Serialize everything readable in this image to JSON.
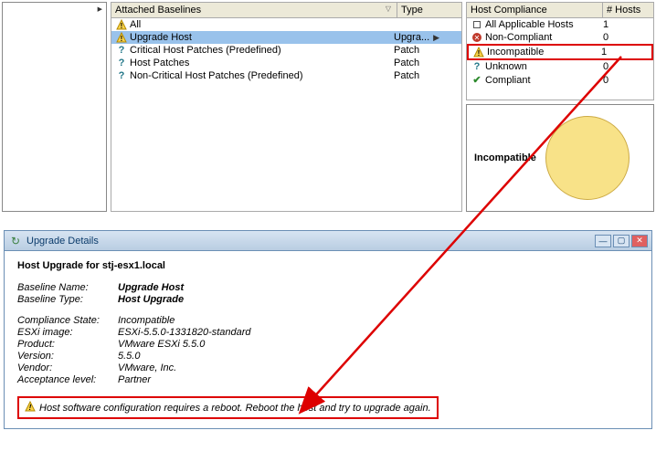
{
  "baselines": {
    "header_name": "Attached Baselines",
    "header_type": "Type",
    "items": [
      {
        "icon": "warn",
        "label": "All",
        "type": ""
      },
      {
        "icon": "warn",
        "label": "Upgrade Host",
        "type": "Upgra...",
        "selected": true,
        "arrow": true
      },
      {
        "icon": "help",
        "label": "Critical Host Patches (Predefined)",
        "type": "Patch"
      },
      {
        "icon": "help",
        "label": "Host Patches",
        "type": "Patch"
      },
      {
        "icon": "help",
        "label": "Non-Critical Host Patches (Predefined)",
        "type": "Patch"
      }
    ]
  },
  "compliance": {
    "header_name": "Host Compliance",
    "header_hosts": "# Hosts",
    "items": [
      {
        "icon": "square",
        "label": "All Applicable Hosts",
        "hosts": 1
      },
      {
        "icon": "cross",
        "label": "Non-Compliant",
        "hosts": 0
      },
      {
        "icon": "warn",
        "label": "Incompatible",
        "hosts": 1,
        "highlight": true
      },
      {
        "icon": "help",
        "label": "Unknown",
        "hosts": 0
      },
      {
        "icon": "check",
        "label": "Compliant",
        "hosts": 0
      }
    ]
  },
  "chart": {
    "label": "Incompatible"
  },
  "chart_data": {
    "type": "pie",
    "title": "Incompatible",
    "series": [
      {
        "name": "Incompatible",
        "value": 1,
        "color": "#f8e288"
      }
    ]
  },
  "dialog": {
    "title": "Upgrade Details",
    "heading": "Host Upgrade for stj-esx1.local",
    "details": [
      {
        "k": "Baseline Name:",
        "v": "Upgrade Host",
        "bold": true
      },
      {
        "k": "Baseline Type:",
        "v": "Host Upgrade",
        "bold": true
      }
    ],
    "details2": [
      {
        "k": "Compliance State:",
        "v": "Incompatible"
      },
      {
        "k": "ESXi image:",
        "v": "ESXi-5.5.0-1331820-standard"
      },
      {
        "k": "Product:",
        "v": "VMware ESXi 5.5.0"
      },
      {
        "k": "Version:",
        "v": "5.5.0"
      },
      {
        "k": "Vendor:",
        "v": "VMware, Inc."
      },
      {
        "k": "Acceptance level:",
        "v": "Partner"
      }
    ],
    "warning": "Host software configuration requires a reboot. Reboot the host and try to upgrade again."
  }
}
